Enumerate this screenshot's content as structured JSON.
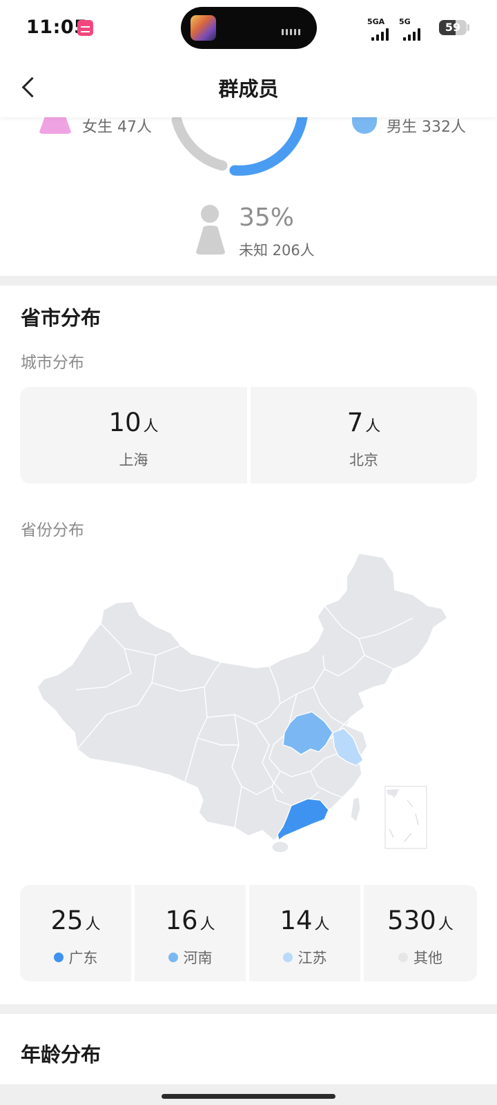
{
  "status_bar": {
    "time": "11:05",
    "signal_1_label": "5GA",
    "signal_2_label": "5G",
    "battery": "59"
  },
  "nav": {
    "title": "群成员"
  },
  "gender": {
    "female_text": "女生 47人",
    "male_text": "男生 332人",
    "unknown_percent": "35%",
    "unknown_text": "未知 206人",
    "colors": {
      "male": "#4a9cf2",
      "other": "#cfcfcf",
      "female": "#f0a3e2"
    }
  },
  "region": {
    "title": "省市分布",
    "city_subtitle": "城市分布",
    "cities": [
      {
        "count": "10",
        "unit": "人",
        "name": "上海"
      },
      {
        "count": "7",
        "unit": "人",
        "name": "北京"
      }
    ],
    "province_subtitle": "省份分布",
    "provinces": [
      {
        "count": "25",
        "unit": "人",
        "name": "广东",
        "color": "#3f93f0"
      },
      {
        "count": "16",
        "unit": "人",
        "name": "河南",
        "color": "#7bb8f3"
      },
      {
        "count": "14",
        "unit": "人",
        "name": "江苏",
        "color": "#b9dafa"
      },
      {
        "count": "530",
        "unit": "人",
        "name": "其他",
        "color": "#e6e6e6"
      }
    ]
  },
  "age": {
    "title": "年龄分布"
  },
  "map_colors": {
    "base": "#e4e6ea",
    "border": "#ffffff"
  }
}
